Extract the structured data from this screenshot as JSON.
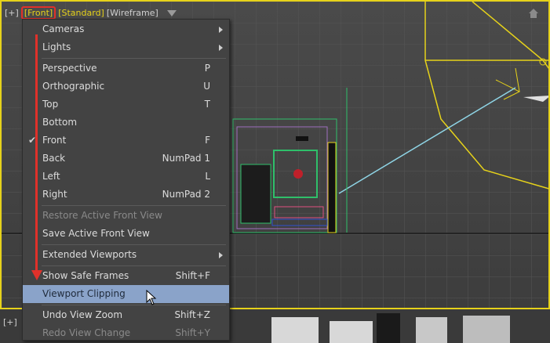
{
  "viewport": {
    "label_plus": "[+]",
    "label_front": "[Front]",
    "label_standard": "[Standard]",
    "label_wireframe": "[Wireframe]",
    "border_color": "#e6d21a",
    "filter_icon": "filter-icon",
    "home_icon": "home-icon"
  },
  "bottom_viewport": {
    "label": "[+]"
  },
  "menu": {
    "highlight_color": "#8aa3c9",
    "items": [
      {
        "label": "Cameras",
        "shortcut": "",
        "submenu": true
      },
      {
        "label": "Lights",
        "shortcut": "",
        "submenu": true
      },
      {
        "label": "Perspective",
        "shortcut": "P"
      },
      {
        "label": "Orthographic",
        "shortcut": "U"
      },
      {
        "label": "Top",
        "shortcut": "T"
      },
      {
        "label": "Bottom",
        "shortcut": ""
      },
      {
        "label": "Front",
        "shortcut": "F",
        "checked": true
      },
      {
        "label": "Back",
        "shortcut": "NumPad 1"
      },
      {
        "label": "Left",
        "shortcut": "L"
      },
      {
        "label": "Right",
        "shortcut": "NumPad 2"
      },
      {
        "label": "Restore Active Front View",
        "shortcut": "",
        "disabled": true
      },
      {
        "label": "Save Active Front View",
        "shortcut": ""
      },
      {
        "label": "Extended Viewports",
        "shortcut": "",
        "submenu": true
      },
      {
        "label": "Show Safe Frames",
        "shortcut": "Shift+F"
      },
      {
        "label": "Viewport Clipping",
        "shortcut": "",
        "highlighted": true
      },
      {
        "label": "Undo View Zoom",
        "shortcut": "Shift+Z"
      },
      {
        "label": "Redo View Change",
        "shortcut": "Shift+Y",
        "disabled": true
      }
    ]
  }
}
